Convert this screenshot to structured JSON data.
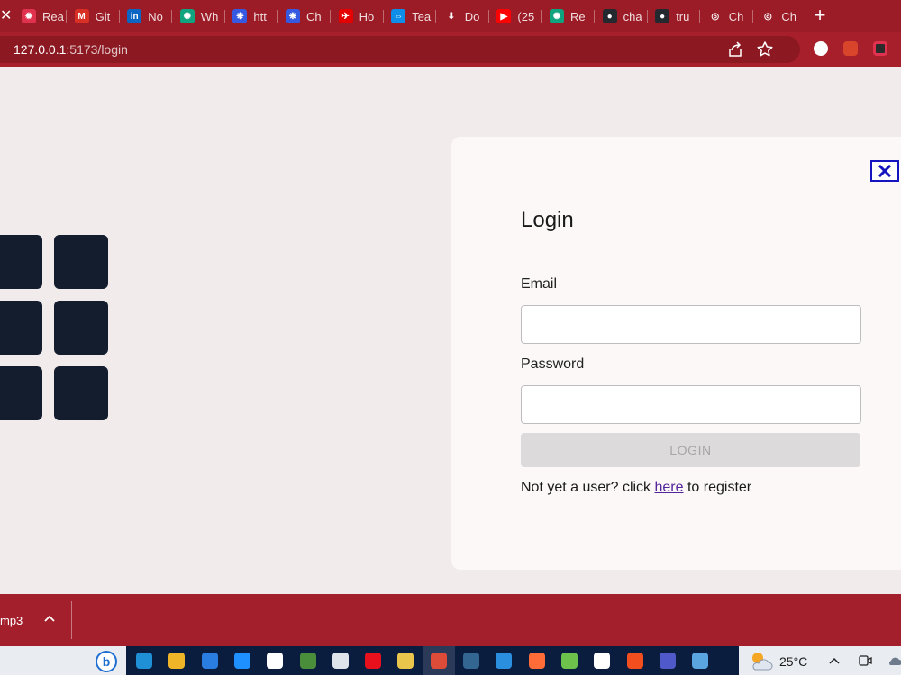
{
  "browser": {
    "tabs": [
      {
        "label": "Rea",
        "icon": "react-icon",
        "color": "#e0324e",
        "glyph": "✹"
      },
      {
        "label": "Git",
        "icon": "gmail-icon",
        "color": "#d93025",
        "glyph": "M"
      },
      {
        "label": "No",
        "icon": "linkedin-icon",
        "color": "#0a66c2",
        "glyph": "in"
      },
      {
        "label": "Wh",
        "icon": "chatgpt-icon",
        "color": "#10a37f",
        "glyph": "✺"
      },
      {
        "label": "htt",
        "icon": "paw-icon",
        "color": "#3559e0",
        "glyph": "❋"
      },
      {
        "label": "Ch",
        "icon": "paw-icon",
        "color": "#3559e0",
        "glyph": "❋"
      },
      {
        "label": "Ho",
        "icon": "airtel-icon",
        "color": "#e40000",
        "glyph": "✈"
      },
      {
        "label": "Tea",
        "icon": "teamviewer-icon",
        "color": "#0e8ee9",
        "glyph": "⇔"
      },
      {
        "label": "Do",
        "icon": "download-icon",
        "color": "#9b1b26",
        "glyph": "⬇"
      },
      {
        "label": "(25",
        "icon": "youtube-icon",
        "color": "#ff0000",
        "glyph": "▶"
      },
      {
        "label": "Re",
        "icon": "chatgpt-icon",
        "color": "#10a37f",
        "glyph": "✺"
      },
      {
        "label": "cha",
        "icon": "github-icon",
        "color": "#24292f",
        "glyph": "●"
      },
      {
        "label": "tru",
        "icon": "github-icon",
        "color": "#24292f",
        "glyph": "●"
      },
      {
        "label": "Ch",
        "icon": "globe-icon",
        "color": "#9b1b26",
        "glyph": "◎"
      },
      {
        "label": "Ch",
        "icon": "globe-icon",
        "color": "#9b1b26",
        "glyph": "◎"
      }
    ],
    "new_tab": "+",
    "url_host": "127.0.0.1",
    "url_path": ":5173/login",
    "theme_color": "#9b1b26"
  },
  "login": {
    "title": "Login",
    "email_label": "Email",
    "email_value": "",
    "password_label": "Password",
    "password_value": "",
    "button_label": "LOGIN",
    "register_prefix": "Not yet a user? click ",
    "register_link": "here",
    "register_suffix": " to register",
    "close_icon": "close-icon",
    "close_color": "#1515c0"
  },
  "download_shelf": {
    "file_name": "mp3"
  },
  "taskbar": {
    "weather": "25°C",
    "apps": [
      "edge-icon",
      "file-explorer-icon",
      "mail-icon",
      "browser-icon",
      "notepad-icon",
      "git-icon",
      "store-icon",
      "opera-icon",
      "slack-icon",
      "chrome-icon",
      "postgres-icon",
      "vscode-icon",
      "postman-icon",
      "node-icon",
      "shield-icon",
      "figma-icon",
      "teams-icon",
      "screen-icon"
    ]
  }
}
